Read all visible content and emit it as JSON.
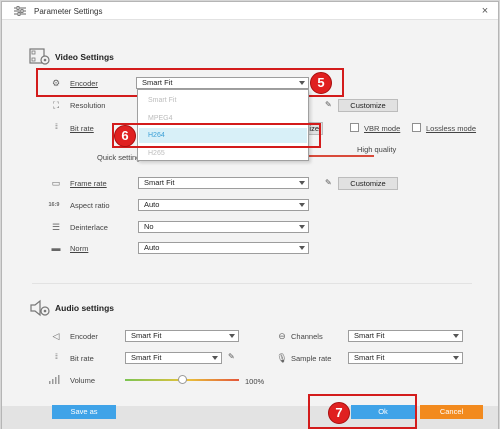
{
  "window": {
    "title": "Parameter Settings",
    "close_glyph": "×"
  },
  "video": {
    "section_title": "Video Settings",
    "encoder": {
      "label": "Encoder",
      "value": "Smart Fit"
    },
    "resolution": {
      "label": "Resolution",
      "customize": "Customize"
    },
    "bitrate": {
      "label": "Bit rate",
      "customize": "ize",
      "vbr_mode": "VBR mode",
      "lossless_mode": "Lossless mode",
      "quick_setting": "Quick setting",
      "high_quality": "High quality"
    },
    "encoder_menu": {
      "items": [
        "Smart Fit",
        "MPEG4",
        "H264",
        "H265"
      ],
      "highlighted_index": 2
    },
    "frame_rate": {
      "label": "Frame rate",
      "value": "Smart Fit",
      "customize": "Customize"
    },
    "aspect_ratio": {
      "label": "Aspect ratio",
      "value": "Auto",
      "icon_text": "16:9"
    },
    "deinterlace": {
      "label": "Deinterlace",
      "value": "No"
    },
    "norm": {
      "label": "Norm",
      "value": "Auto"
    }
  },
  "audio": {
    "section_title": "Audio settings",
    "encoder": {
      "label": "Encoder",
      "value": "Smart Fit"
    },
    "channels": {
      "label": "Channels",
      "value": "Smart Fit"
    },
    "bitrate": {
      "label": "Bit rate",
      "value": "Smart Fit"
    },
    "sample_rate": {
      "label": "Sample rate",
      "value": "Smart Fit"
    },
    "volume": {
      "label": "Volume",
      "value_text": "100%",
      "level": 0.5
    }
  },
  "footer": {
    "save_as": "Save as",
    "ok": "Ok",
    "cancel": "Cancel"
  },
  "annotations": {
    "step5": "5",
    "step6": "6",
    "step7": "7"
  },
  "colors": {
    "accent_blue": "#3fa3e8",
    "cancel_orange": "#f28a1e",
    "highlight_red": "#d31b1b",
    "menu_highlight": "#d8f0f8"
  }
}
